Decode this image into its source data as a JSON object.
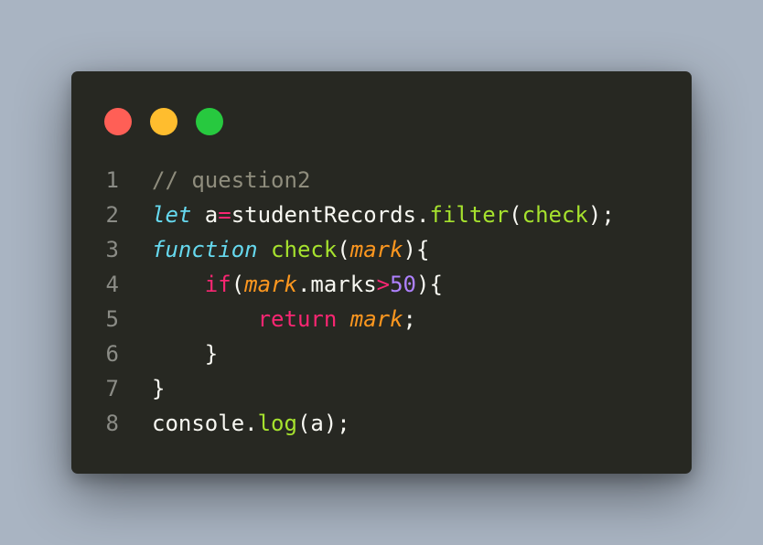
{
  "window": {
    "buttons": [
      {
        "name": "close",
        "color": "#ff5f56"
      },
      {
        "name": "minimize",
        "color": "#ffbd2e"
      },
      {
        "name": "maximize",
        "color": "#27c93f"
      }
    ]
  },
  "colors": {
    "background": "#a9b4c2",
    "editor": "#272822",
    "comment": "#8f8d7d",
    "plain": "#f8f8f2",
    "keyword_storage": "#66d9ef",
    "keyword_control": "#f92672",
    "function_name": "#a6e22e",
    "parameter": "#fd971f",
    "number": "#ae81ff",
    "operator": "#f92672"
  },
  "lines": [
    {
      "number": "1",
      "tokens": [
        {
          "text": "// question2",
          "type": "comment"
        }
      ]
    },
    {
      "number": "2",
      "tokens": [
        {
          "text": "let",
          "type": "keyword_storage",
          "italic": true
        },
        {
          "text": " a",
          "type": "plain"
        },
        {
          "text": "=",
          "type": "operator"
        },
        {
          "text": "studentRecords.",
          "type": "plain"
        },
        {
          "text": "filter",
          "type": "function_name"
        },
        {
          "text": "(",
          "type": "plain"
        },
        {
          "text": "check",
          "type": "function_name"
        },
        {
          "text": ");",
          "type": "plain"
        }
      ]
    },
    {
      "number": "3",
      "tokens": [
        {
          "text": "function",
          "type": "keyword_storage",
          "italic": true
        },
        {
          "text": " ",
          "type": "plain"
        },
        {
          "text": "check",
          "type": "function_name"
        },
        {
          "text": "(",
          "type": "plain"
        },
        {
          "text": "mark",
          "type": "parameter",
          "italic": true
        },
        {
          "text": "){",
          "type": "plain"
        }
      ]
    },
    {
      "number": "4",
      "tokens": [
        {
          "text": "    ",
          "type": "plain"
        },
        {
          "text": "if",
          "type": "keyword_control"
        },
        {
          "text": "(",
          "type": "plain"
        },
        {
          "text": "mark",
          "type": "parameter",
          "italic": true
        },
        {
          "text": ".marks",
          "type": "plain"
        },
        {
          "text": ">",
          "type": "operator"
        },
        {
          "text": "50",
          "type": "number"
        },
        {
          "text": "){",
          "type": "plain"
        }
      ]
    },
    {
      "number": "5",
      "tokens": [
        {
          "text": "        ",
          "type": "plain"
        },
        {
          "text": "return",
          "type": "keyword_control"
        },
        {
          "text": " ",
          "type": "plain"
        },
        {
          "text": "mark",
          "type": "parameter",
          "italic": true
        },
        {
          "text": ";",
          "type": "plain"
        }
      ]
    },
    {
      "number": "6",
      "tokens": [
        {
          "text": "    }",
          "type": "plain"
        }
      ]
    },
    {
      "number": "7",
      "tokens": [
        {
          "text": "}",
          "type": "plain"
        }
      ]
    },
    {
      "number": "8",
      "tokens": [
        {
          "text": "console.",
          "type": "plain"
        },
        {
          "text": "log",
          "type": "function_name"
        },
        {
          "text": "(a);",
          "type": "plain"
        }
      ]
    }
  ]
}
